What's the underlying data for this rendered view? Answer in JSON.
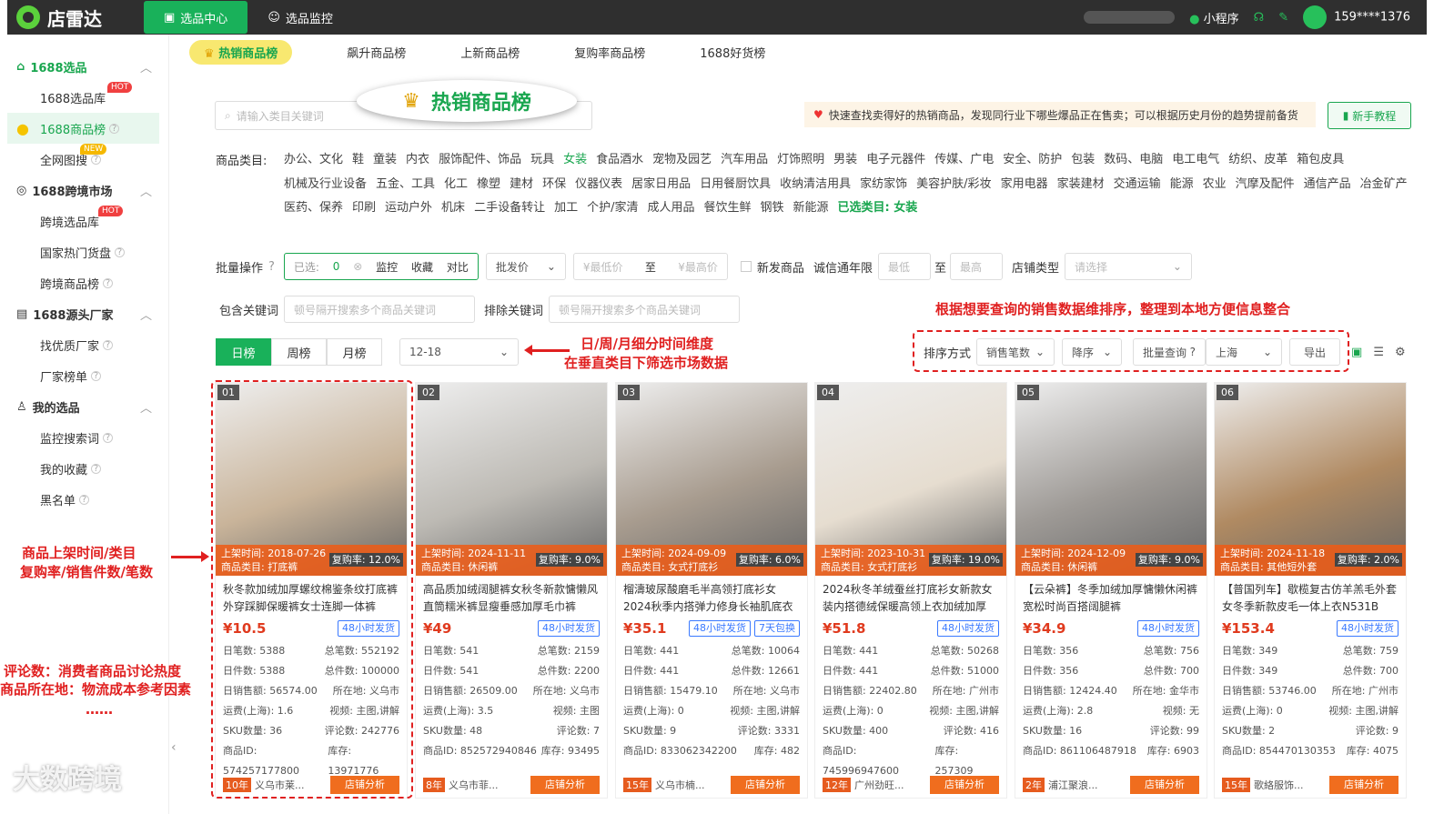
{
  "topbar": {
    "brand": "店雷达",
    "nav": [
      {
        "label": "选品中心"
      },
      {
        "label": "选品监控"
      }
    ],
    "mini_program": "小程序",
    "user": "159****1376"
  },
  "sidebar": {
    "groups": [
      {
        "title": "1688选品",
        "items": [
          {
            "label": "1688选品库",
            "badge": "HOT"
          },
          {
            "label": "1688商品榜"
          },
          {
            "label": "全网图搜",
            "badge": "NEW"
          }
        ]
      },
      {
        "title": "1688跨境市场",
        "items": [
          {
            "label": "跨境选品库",
            "badge": "HOT"
          },
          {
            "label": "国家热门货盘"
          },
          {
            "label": "跨境商品榜"
          }
        ]
      },
      {
        "title": "1688源头厂家",
        "items": [
          {
            "label": "找优质厂家"
          },
          {
            "label": "厂家榜单"
          }
        ]
      },
      {
        "title": "我的选品",
        "items": [
          {
            "label": "监控搜索词"
          },
          {
            "label": "我的收藏"
          },
          {
            "label": "黑名单"
          }
        ]
      }
    ]
  },
  "tabs": [
    "热销商品榜",
    "飙升商品榜",
    "上新商品榜",
    "复购率商品榜",
    "1688好货榜"
  ],
  "callout": "热销商品榜",
  "search": {
    "placeholder": "请输入类目关键词"
  },
  "tip": "快速查找卖得好的热销商品，发现同行业下哪些爆品正在售卖；可以根据历史月份的趋势提前备货",
  "guide_btn": "新手教程",
  "category_label": "商品类目:",
  "categories": [
    "办公、文化",
    "鞋",
    "童装",
    "内衣",
    "服饰配件、饰品",
    "玩具",
    "女装",
    "食品酒水",
    "宠物及园艺",
    "汽车用品",
    "灯饰照明",
    "男装",
    "电子元器件",
    "传媒、广电",
    "安全、防护",
    "包装",
    "数码、电脑",
    "电工电气",
    "纺织、皮革",
    "箱包皮具",
    "机械及行业设备",
    "五金、工具",
    "化工",
    "橡塑",
    "建材",
    "环保",
    "仪器仪表",
    "居家日用品",
    "日用餐厨饮具",
    "收纳清洁用具",
    "家纺家饰",
    "美容护肤/彩妆",
    "家用电器",
    "家装建材",
    "交通运输",
    "能源",
    "农业",
    "汽摩及配件",
    "通信产品",
    "冶金矿产",
    "医药、保养",
    "印刷",
    "运动户外",
    "机床",
    "二手设备转让",
    "加工",
    "个护/家清",
    "成人用品",
    "餐饮生鲜",
    "钢铁",
    "新能源"
  ],
  "selected_category": "女装",
  "chosen_label": "已选类目: 女装",
  "filters": {
    "batch_label": "批量操作",
    "selected_text": "已选:",
    "selected_count": "0",
    "monitor": "监控",
    "collect": "收藏",
    "compare": "对比",
    "price_type": "批发价",
    "min_price": "¥最低价",
    "to": "至",
    "max_price": "¥最高价",
    "new_goods": "新发商品",
    "trust_label": "诚信通年限",
    "min": "最低",
    "max": "最高",
    "shop_type_label": "店铺类型",
    "shop_type_placeholder": "请选择",
    "include_label": "包含关键词",
    "include_placeholder": "顿号隔开搜索多个商品关键词",
    "exclude_label": "排除关键词",
    "exclude_placeholder": "顿号隔开搜索多个商品关键词"
  },
  "period": {
    "day": "日榜",
    "week": "周榜",
    "month": "月榜",
    "date": "12-18"
  },
  "sort": {
    "label": "排序方式",
    "field": "销售笔数",
    "order": "降序",
    "batch_query": "批量查询",
    "region": "上海",
    "export": "导出"
  },
  "annotations": {
    "sort_note": "根据想要查询的销售数据维排序，整理到本地方便信息整合",
    "time_note_1": "日/周/月细分时间维度",
    "time_note_2": "在垂直类目下筛选市场数据",
    "card_note_1": "商品上架时间/类目",
    "card_note_2": "复购率/销售件数/笔数",
    "review_note_1": "评论数：消费者商品讨论热度",
    "review_note_2": "商品所在地：物流成本参考因素",
    "review_note_3": "……"
  },
  "labels": {
    "listed": "上架时间:",
    "category": "商品类目:",
    "repurchase": "复购率:",
    "day_orders": "日笔数:",
    "total_orders": "总笔数:",
    "day_pieces": "日件数:",
    "total_pieces": "总件数:",
    "day_sales": "日销售额:",
    "location": "所在地:",
    "freight": "运费(上海):",
    "video": "视频:",
    "sku": "SKU数量:",
    "reviews": "评论数:",
    "product_id": "商品ID:",
    "stock": "库存:",
    "shop_analysis": "店铺分析",
    "tag48": "48小时发货"
  },
  "products": [
    {
      "rank": "01",
      "listed": "2018-07-26",
      "category": "打底裤",
      "repurchase": "12.0%",
      "title": "秋冬款加绒加厚螺纹棉鉴条纹打底裤外穿踩脚保暖裤女士连脚一体裤",
      "price": "¥10.5",
      "day_orders": "5388",
      "total_orders": "552192",
      "day_pieces": "5388",
      "total_pieces": "100000",
      "day_sales": "56574.00",
      "location": "义乌市",
      "freight": "1.6",
      "video": "主图,讲解",
      "sku": "36",
      "reviews": "242776",
      "pid": "574257177800",
      "stock": "13971776",
      "years": "10年",
      "shop": "义乌市莱...",
      "extra_tag": "",
      "img": "#c9b49a"
    },
    {
      "rank": "02",
      "listed": "2024-11-11",
      "category": "休闲裤",
      "repurchase": "9.0%",
      "title": "高品质加绒阔腿裤女秋冬新款慵懒风直筒糯米裤显瘦垂感加厚毛巾裤",
      "price": "¥49",
      "day_orders": "541",
      "total_orders": "2159",
      "day_pieces": "541",
      "total_pieces": "2200",
      "day_sales": "26509.00",
      "location": "义乌市",
      "freight": "3.5",
      "video": "主图",
      "sku": "48",
      "reviews": "7",
      "pid": "852572940846",
      "stock": "93495",
      "years": "8年",
      "shop": "义乌市菲...",
      "extra_tag": "",
      "img": "#bdbab4"
    },
    {
      "rank": "03",
      "listed": "2024-09-09",
      "category": "女式打底衫",
      "repurchase": "6.0%",
      "title": "榴濤玻尿酸磨毛半高领打底衫女2024秋季内搭弹力修身长袖肌底衣",
      "price": "¥35.1",
      "day_orders": "441",
      "total_orders": "10064",
      "day_pieces": "441",
      "total_pieces": "12661",
      "day_sales": "15479.10",
      "location": "义乌市",
      "freight": "0",
      "video": "主图,讲解",
      "sku": "9",
      "reviews": "3331",
      "pid": "833062342200",
      "stock": "482",
      "years": "15年",
      "shop": "义乌市楠...",
      "extra_tag": "7天包换",
      "img": "#a89c8f"
    },
    {
      "rank": "04",
      "listed": "2023-10-31",
      "category": "女式打底衫",
      "repurchase": "19.0%",
      "title": "2024秋冬羊绒蚕丝打底衫女新款女装内搭德绒保暖高领上衣加绒加厚",
      "price": "¥51.8",
      "day_orders": "441",
      "total_orders": "50268",
      "day_pieces": "441",
      "total_pieces": "51000",
      "day_sales": "22402.80",
      "location": "广州市",
      "freight": "0",
      "video": "主图,讲解",
      "sku": "400",
      "reviews": "416",
      "pid": "745996947600",
      "stock": "257309",
      "years": "12年",
      "shop": "广州劲旺...",
      "extra_tag": "",
      "img": "#e6ddd0"
    },
    {
      "rank": "05",
      "listed": "2024-12-09",
      "category": "休闲裤",
      "repurchase": "9.0%",
      "title": "【云朵裤】冬季加绒加厚慵懒休闲裤宽松时尚百搭阔腿裤",
      "price": "¥34.9",
      "day_orders": "356",
      "total_orders": "756",
      "day_pieces": "356",
      "total_pieces": "700",
      "day_sales": "12424.40",
      "location": "金华市",
      "freight": "2.8",
      "video": "无",
      "sku": "16",
      "reviews": "99",
      "pid": "861106487918",
      "stock": "6903",
      "years": "2年",
      "shop": "浦江聚浪...",
      "extra_tag": "",
      "img": "#9e9a96"
    },
    {
      "rank": "06",
      "listed": "2024-11-18",
      "category": "其他短外套",
      "repurchase": "2.0%",
      "title": "【普国列车】歇榄复古仿羊羔毛外套女冬季新款皮毛一体上衣N531B",
      "price": "¥153.4",
      "day_orders": "349",
      "total_orders": "759",
      "day_pieces": "349",
      "total_pieces": "700",
      "day_sales": "53746.00",
      "location": "广州市",
      "freight": "0",
      "video": "主图,讲解",
      "sku": "2",
      "reviews": "9",
      "pid": "854470130353",
      "stock": "4075",
      "years": "15年",
      "shop": "歌絡服饰...",
      "extra_tag": "",
      "img": "#b08a62"
    }
  ],
  "watermark": "大数跨境",
  "colors": {
    "accent": "#19b15a",
    "price": "#e03a1e",
    "annot": "#e02020"
  }
}
